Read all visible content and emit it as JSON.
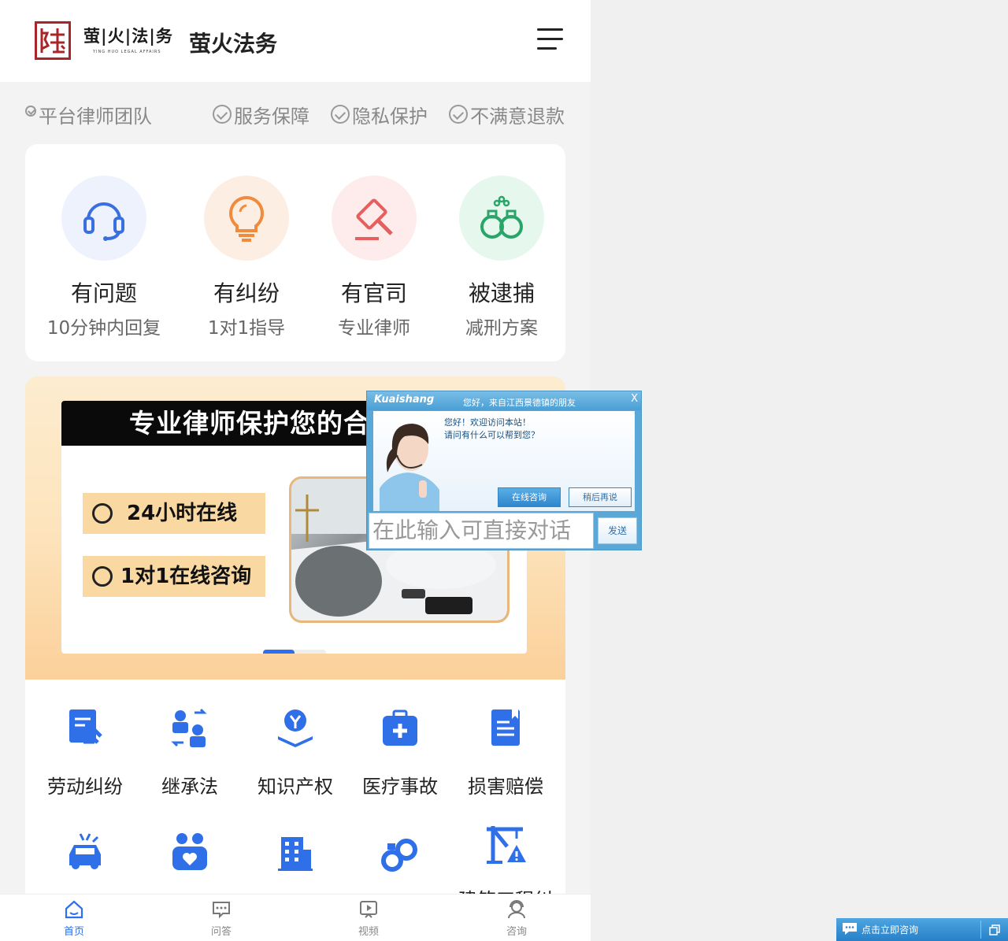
{
  "header": {
    "logo_text": "萤|火|法|务",
    "logo_en": "YING HUO LEGAL AFFAIRS",
    "title": "萤火法务"
  },
  "guarantees": [
    "平台律师团队",
    "服务保障",
    "隐私保护",
    "不满意退款"
  ],
  "services": [
    {
      "title": "有问题",
      "subtitle": "10分钟内回复",
      "icon": "headset-icon",
      "color": "#3a6fe0",
      "bg": "#eef2fd"
    },
    {
      "title": "有纠纷",
      "subtitle": "1对1指导",
      "icon": "lightbulb-icon",
      "color": "#f08a3c",
      "bg": "#fdeee4"
    },
    {
      "title": "有官司",
      "subtitle": "专业律师",
      "icon": "gavel-icon",
      "color": "#e85d5d",
      "bg": "#fdeceb"
    },
    {
      "title": "被逮捕",
      "subtitle": "减刑方案",
      "icon": "handcuffs-icon",
      "color": "#2aa56a",
      "bg": "#e6f7ee"
    }
  ],
  "banner": {
    "headline": "专业律师保护您的合",
    "pill1": "24小时在线",
    "pill2": "1对1在线咨询",
    "active_slide": 1,
    "slide_count": 2
  },
  "categories": [
    {
      "label": "劳动纠纷",
      "icon": "labor-document-icon"
    },
    {
      "label": "继承法",
      "icon": "inheritance-icon"
    },
    {
      "label": "知识产权",
      "icon": "intellectual-property-icon"
    },
    {
      "label": "医疗事故",
      "icon": "medical-kit-icon"
    },
    {
      "label": "损害赔偿",
      "icon": "compensation-document-icon"
    },
    {
      "label": "",
      "icon": "car-accident-icon"
    },
    {
      "label": "",
      "icon": "family-icon"
    },
    {
      "label": "",
      "icon": "building-icon"
    },
    {
      "label": "",
      "icon": "handcuffs-icon"
    },
    {
      "label": "建筑工程纠",
      "icon": "construction-crane-icon"
    }
  ],
  "tabs": [
    {
      "label": "首页",
      "icon": "home-icon",
      "active": true
    },
    {
      "label": "问答",
      "icon": "chat-icon",
      "active": false
    },
    {
      "label": "视频",
      "icon": "video-icon",
      "active": false
    },
    {
      "label": "咨询",
      "icon": "consultant-icon",
      "active": false
    }
  ],
  "chat": {
    "brand": "Kuaishang",
    "greeting": "您好，来自江西景德镇的朋友",
    "close": "X",
    "msg1": "您好！欢迎访问本站！",
    "msg2": "请问有什么可以帮到您？",
    "btn_online": "在线咨询",
    "btn_later": "稍后再说",
    "input_placeholder": "在此输入可直接对话",
    "send": "发送"
  },
  "consult_bar": {
    "label": "点击立即咨询"
  },
  "colors": {
    "accent": "#2c6ff0",
    "brand_red": "#a8262a",
    "category_blue": "#2f6fe8"
  }
}
